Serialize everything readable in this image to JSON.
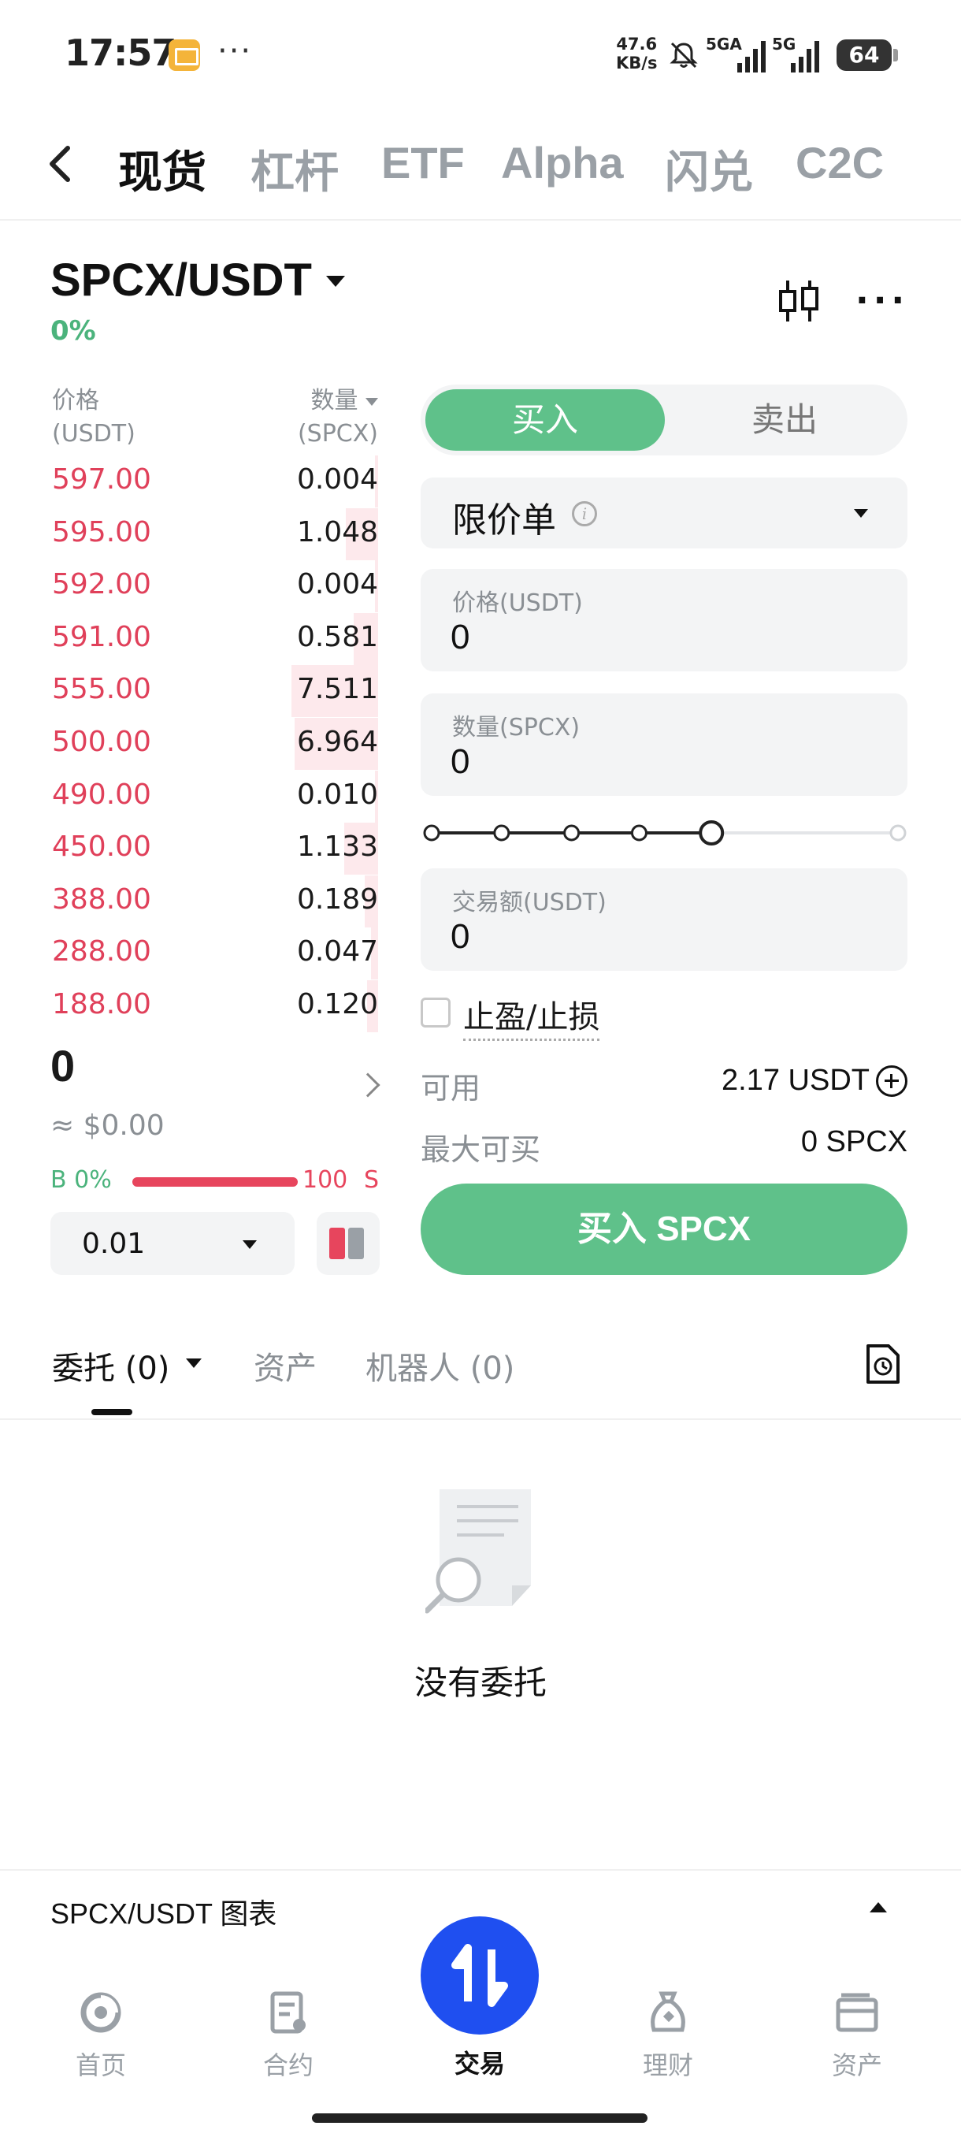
{
  "status_bar": {
    "time": "17:57",
    "speed_value": "47.6",
    "speed_unit": "KB/s",
    "sig1": "5GA",
    "sig2": "5G",
    "battery": "64"
  },
  "nav": {
    "tabs": [
      "现货",
      "杠杆",
      "ETF",
      "Alpha",
      "闪兑",
      "C2C"
    ],
    "active_tab": "现货"
  },
  "pair": {
    "name": "SPCX/USDT",
    "change": "0%"
  },
  "order_book": {
    "price_header": "价格",
    "price_unit": "(USDT)",
    "qty_header": "数量",
    "qty_unit": "(SPCX)",
    "asks": [
      {
        "price": "597.00",
        "qty": "0.004"
      },
      {
        "price": "595.00",
        "qty": "1.048"
      },
      {
        "price": "592.00",
        "qty": "0.004"
      },
      {
        "price": "591.00",
        "qty": "0.581"
      },
      {
        "price": "555.00",
        "qty": "7.511"
      },
      {
        "price": "500.00",
        "qty": "6.964"
      },
      {
        "price": "490.00",
        "qty": "0.010"
      },
      {
        "price": "450.00",
        "qty": "1.133"
      },
      {
        "price": "388.00",
        "qty": "0.189"
      },
      {
        "price": "288.00",
        "qty": "0.047"
      },
      {
        "price": "188.00",
        "qty": "0.120"
      }
    ],
    "last_price": "0",
    "usd_value": "≈ $0.00",
    "buy_ratio": "B 0%",
    "sell_ratio": "100",
    "sell_letter": "S",
    "precision": "0.01"
  },
  "order_form": {
    "buy_label": "买入",
    "sell_label": "卖出",
    "order_type": "限价单",
    "price_label": "价格(USDT)",
    "price_value": "0",
    "qty_label": "数量(SPCX)",
    "qty_value": "0",
    "slider_percent": 60,
    "total_label": "交易额(USDT)",
    "total_value": "0",
    "tpsl_label": "止盈/止损",
    "available_label": "可用",
    "available_value": "2.17 USDT",
    "max_buy_label": "最大可买",
    "max_buy_value": "0 SPCX",
    "submit_label": "买入 SPCX"
  },
  "orders": {
    "tabs": [
      "委托 (0)",
      "资产",
      "机器人 (0)"
    ],
    "empty_text": "没有委托"
  },
  "chart_bar": {
    "label": "SPCX/USDT 图表"
  },
  "bottom_nav": {
    "items": [
      "首页",
      "合约",
      "交易",
      "理财",
      "资产"
    ],
    "active": "交易"
  },
  "colors": {
    "buy_green": "#5fc18a",
    "ask_red": "#e0405a",
    "trade_blue": "#1f4ff0"
  }
}
